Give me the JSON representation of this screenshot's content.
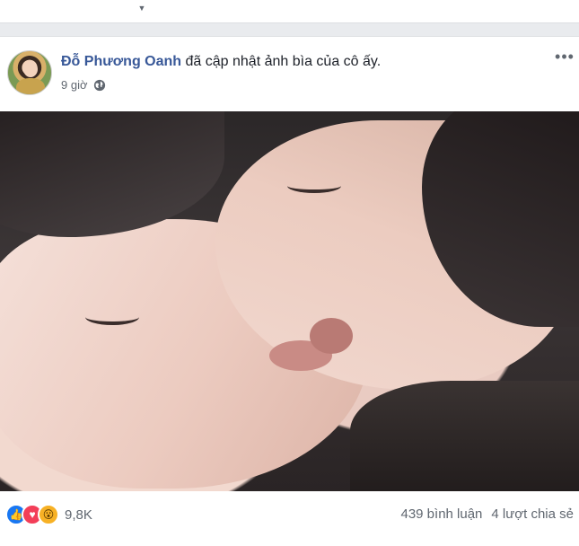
{
  "post": {
    "author": "Đỗ Phương Oanh",
    "action": "đã cập nhật ảnh bìa của cô ấy.",
    "time": "9 giờ",
    "privacy_icon": "globe-icon",
    "more_icon": "more-icon"
  },
  "stats": {
    "reactions": [
      "like-icon",
      "love-icon",
      "wow-icon"
    ],
    "reaction_count": "9,8K",
    "comments": "439 bình luận",
    "shares": "4 lượt chia sẻ"
  },
  "colors": {
    "author_link": "#385898",
    "like": "#1877f2",
    "love": "#f33e58",
    "wow": "#f7b125"
  }
}
